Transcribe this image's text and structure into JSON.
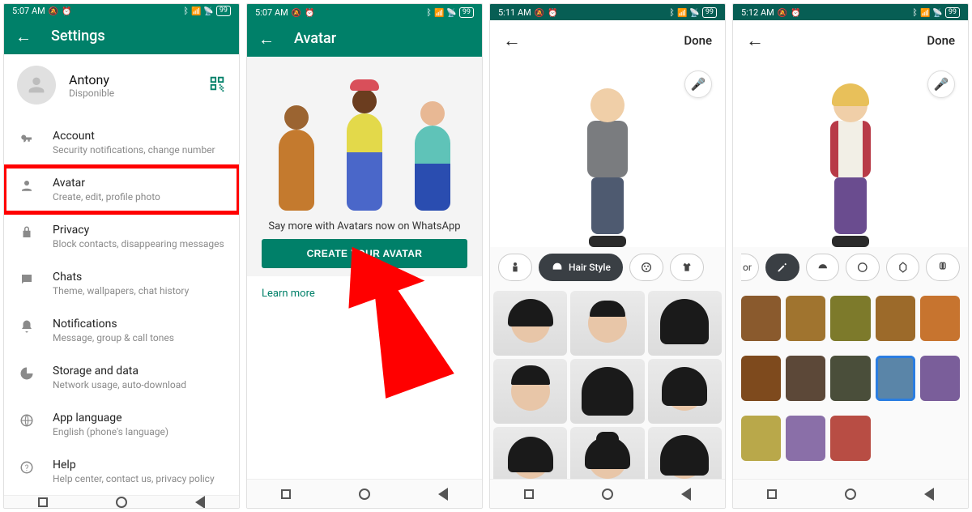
{
  "s1": {
    "status_time": "5:07 AM",
    "battery": "99",
    "title": "Settings",
    "profile": {
      "name": "Antony",
      "status": "Disponible"
    },
    "items": [
      {
        "title": "Account",
        "sub": "Security notifications, change number"
      },
      {
        "title": "Avatar",
        "sub": "Create, edit, profile photo"
      },
      {
        "title": "Privacy",
        "sub": "Block contacts, disappearing messages"
      },
      {
        "title": "Chats",
        "sub": "Theme, wallpapers, chat history"
      },
      {
        "title": "Notifications",
        "sub": "Message, group & call tones"
      },
      {
        "title": "Storage and data",
        "sub": "Network usage, auto-download"
      },
      {
        "title": "App language",
        "sub": "English (phone's language)"
      },
      {
        "title": "Help",
        "sub": "Help center, contact us, privacy policy"
      }
    ]
  },
  "s2": {
    "status_time": "5:07 AM",
    "battery": "99",
    "title": "Avatar",
    "hero_text": "Say more with Avatars now on WhatsApp",
    "cta": "CREATE YOUR AVATAR",
    "learn": "Learn more"
  },
  "s3": {
    "status_time": "5:11 AM",
    "battery": "99",
    "done": "Done",
    "chip_active": "Hair Style"
  },
  "s4": {
    "status_time": "5:12 AM",
    "battery": "99",
    "done": "Done",
    "chip_partial": "or",
    "colors": [
      "#8a5a2d",
      "#a0742f",
      "#7d7a2b",
      "#9c6a2a",
      "#c7742f",
      "#7e4a1d",
      "#5c4838",
      "#4a4e3a",
      "#5a85a8",
      "#7a5e9a",
      "#b9a84a",
      "#8a6fa8",
      "#b84d44"
    ],
    "selected_index": 8
  }
}
